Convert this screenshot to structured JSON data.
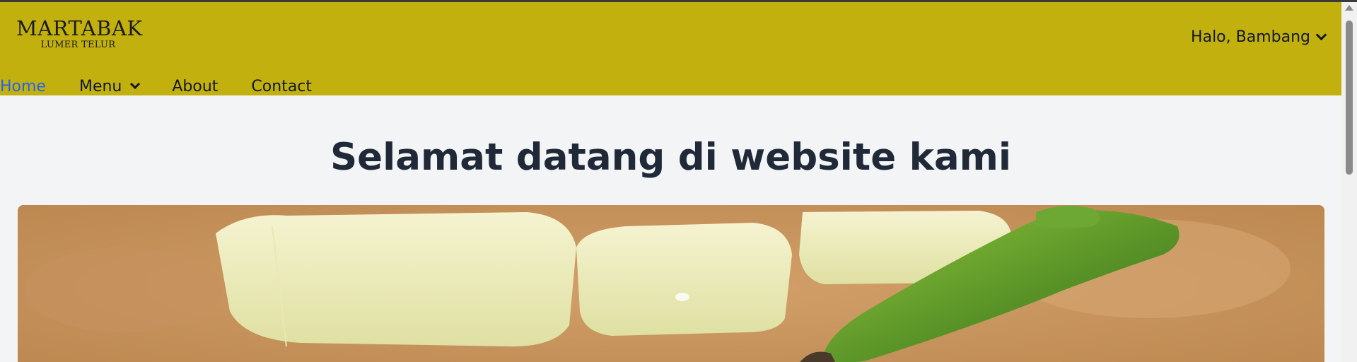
{
  "header": {
    "logo": {
      "line1": "MARTABAK",
      "line2": "LUMER TELUR"
    },
    "user_greeting": "Halo, Bambang",
    "bg_color": "#c2b00f"
  },
  "nav": {
    "items": [
      {
        "label": "Home",
        "active": true
      },
      {
        "label": "Menu",
        "has_dropdown": true
      },
      {
        "label": "About"
      },
      {
        "label": "Contact"
      }
    ],
    "active_color": "#2563eb"
  },
  "main": {
    "title": "Selamat datang di website kami",
    "hero_image": "martabak-food-photo"
  }
}
